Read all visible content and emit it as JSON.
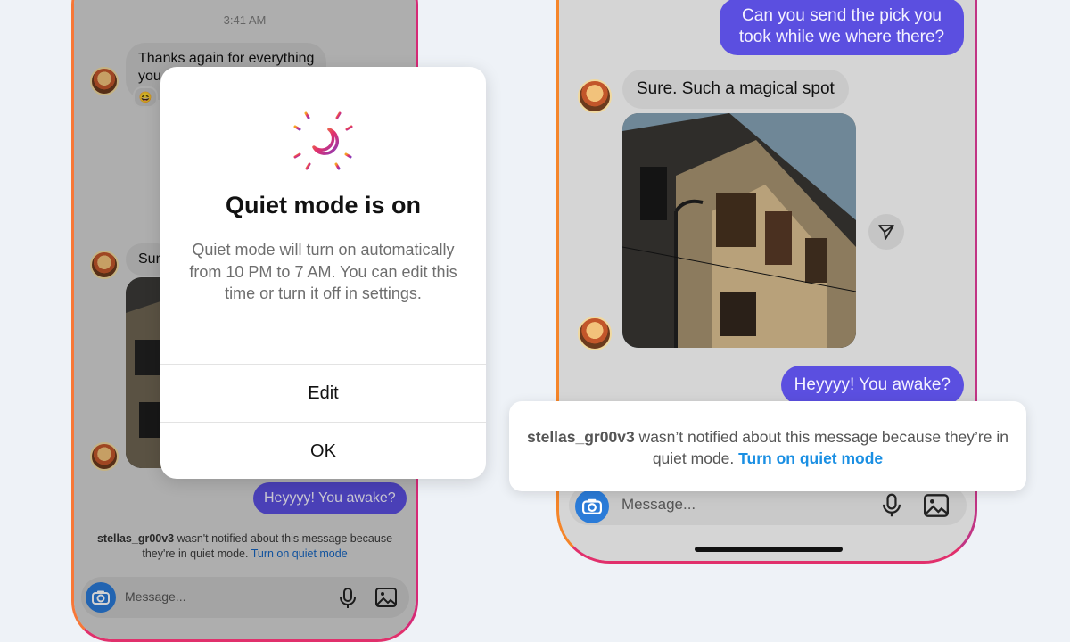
{
  "left_phone": {
    "timestamp": "3:41 AM",
    "message_1": "Thanks again for everything",
    "message_1_cut": "you",
    "reaction": "😆",
    "message_2_cut": "Sur",
    "outgoing_message": "Heyyyy! You awake?",
    "notice": {
      "username": "stellas_gr00v3",
      "text": " wasn't notified about this message because they're in quiet mode. ",
      "link": "Turn on quiet mode"
    },
    "composer_placeholder": "Message..."
  },
  "modal": {
    "title": "Quiet mode is on",
    "body": "Quiet mode will turn on automatically from 10 PM to 7 AM. You can edit this time or turn it off in settings.",
    "edit_label": "Edit",
    "ok_label": "OK",
    "icon": "moon-icon"
  },
  "right_phone": {
    "outgoing_message_top": "Can you send the pick you took while we where there?",
    "incoming_message": "Sure. Such a magical spot",
    "outgoing_message": "Heyyyy! You awake?",
    "composer_placeholder": "Message..."
  },
  "toast": {
    "username": "stellas_gr00v3",
    "text": " wasn’t notified about this message because they’re in quiet mode. ",
    "link": "Turn on quiet mode"
  },
  "colors": {
    "accent_purple": "#5b4fe0",
    "link_blue": "#1a8fe3",
    "camera_blue": "#2a7bd8",
    "ig_gradient": [
      "#f58529",
      "#e1306c",
      "#c13584"
    ]
  }
}
